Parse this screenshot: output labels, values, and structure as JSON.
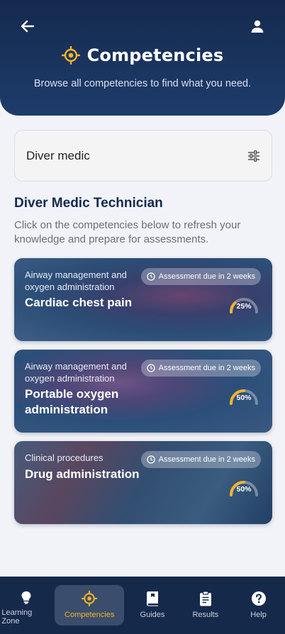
{
  "header": {
    "title": "Competencies",
    "subtitle": "Browse all competencies  to find what you need.",
    "back_icon": "arrow-left-icon",
    "profile_icon": "user-icon",
    "accent": "#f3b42a"
  },
  "search": {
    "value": "Diver medic",
    "filter_icon": "sliders-icon"
  },
  "section": {
    "title": "Diver Medic Technician",
    "description": "Click on the competencies below to refresh your knowledge and prepare for assessments."
  },
  "cards": [
    {
      "category": "Airway management and oxygen administration",
      "title": "Cardiac chest pain",
      "badge": "Assessment due in 2 weeks",
      "progress_label": "25%",
      "progress": 0.25
    },
    {
      "category": "Airway management and oxygen administration",
      "title": "Portable oxygen administration",
      "badge": "Assessment due in 2 weeks",
      "progress_label": "50%",
      "progress": 0.5
    },
    {
      "category": "Clinical procedures",
      "title": "Drug administration",
      "badge": "Assessment due in 2 weeks",
      "progress_label": "50%",
      "progress": 0.5
    }
  ],
  "nav": [
    {
      "label": "Learning Zone",
      "icon": "lightbulb-icon",
      "active": false
    },
    {
      "label": "Competencies",
      "icon": "target-icon",
      "active": true
    },
    {
      "label": "Guides",
      "icon": "book-icon",
      "active": false
    },
    {
      "label": "Results",
      "icon": "clipboard-icon",
      "active": false
    },
    {
      "label": "Help",
      "icon": "help-icon",
      "active": false
    }
  ]
}
